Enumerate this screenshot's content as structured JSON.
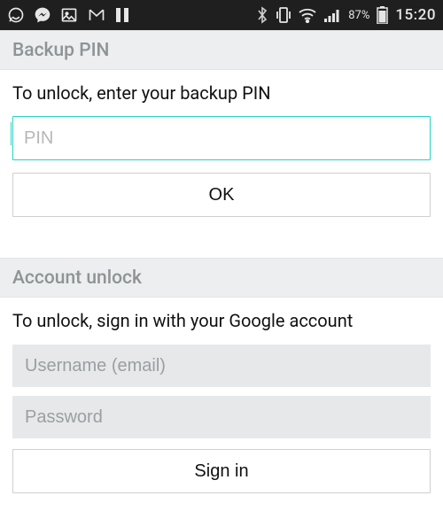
{
  "statusbar": {
    "battery_pct": "87%",
    "time": "15:20"
  },
  "backup_pin": {
    "header": "Backup PIN",
    "instruction": "To unlock, enter your backup PIN",
    "pin_placeholder": "PIN",
    "pin_value": "",
    "ok_label": "OK"
  },
  "account_unlock": {
    "header": "Account unlock",
    "instruction": "To unlock, sign in with your Google account",
    "username_placeholder": "Username (email)",
    "username_value": "",
    "password_placeholder": "Password",
    "password_value": "",
    "signin_label": "Sign in"
  }
}
